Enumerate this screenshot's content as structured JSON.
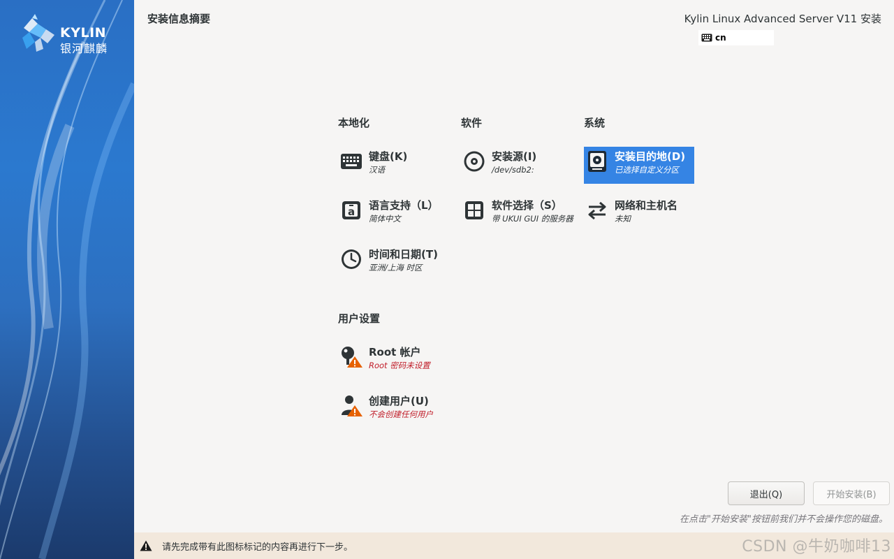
{
  "sidebar": {
    "logo_en": "KYLIN",
    "logo_cn": "银河麒麟"
  },
  "header": {
    "title": "安装信息摘要",
    "product": "Kylin Linux Advanced Server V11 安装",
    "keyboard_layout": "cn"
  },
  "sections": {
    "localization": "本地化",
    "software": "软件",
    "system": "系统",
    "user_settings": "用户设置"
  },
  "spokes": {
    "keyboard": {
      "name": "键盘(K)",
      "status": "汉语",
      "icon": "keyboard-icon"
    },
    "language": {
      "name": "语言支持（L）",
      "status": "简体中文",
      "icon": "language-icon"
    },
    "time": {
      "name": "时间和日期(T)",
      "status": "亚洲/上海 时区",
      "icon": "clock-icon"
    },
    "source": {
      "name": "安装源(I)",
      "status": "/dev/sdb2:",
      "icon": "disc-icon"
    },
    "software_selection": {
      "name": "软件选择（S）",
      "status": "带 UKUI GUI 的服务器",
      "icon": "package-icon"
    },
    "destination": {
      "name": "安装目的地(D)",
      "status": "已选择自定义分区",
      "icon": "harddisk-icon"
    },
    "network": {
      "name": "网络和主机名",
      "status": "未知",
      "icon": "network-arrows-icon"
    },
    "root": {
      "name": "Root 帐户",
      "status": "Root 密码未设置",
      "icon": "root-key-icon"
    },
    "user": {
      "name": "创建用户(U)",
      "status": "不会创建任何用户",
      "icon": "user-icon"
    }
  },
  "buttons": {
    "quit": "退出(Q)",
    "begin": "开始安装(B)"
  },
  "hint": "在点击\"开始安装\"按钮前我们并不会操作您的磁盘。",
  "warning": "请先完成带有此图标标记的内容再进行下一步。",
  "watermark": "CSDN @牛奶咖啡13",
  "colors": {
    "selected": "#3584e4",
    "warning_text": "#c01c28",
    "warning_bar": "#f2e8dc",
    "warning_icon": "#e66100"
  }
}
